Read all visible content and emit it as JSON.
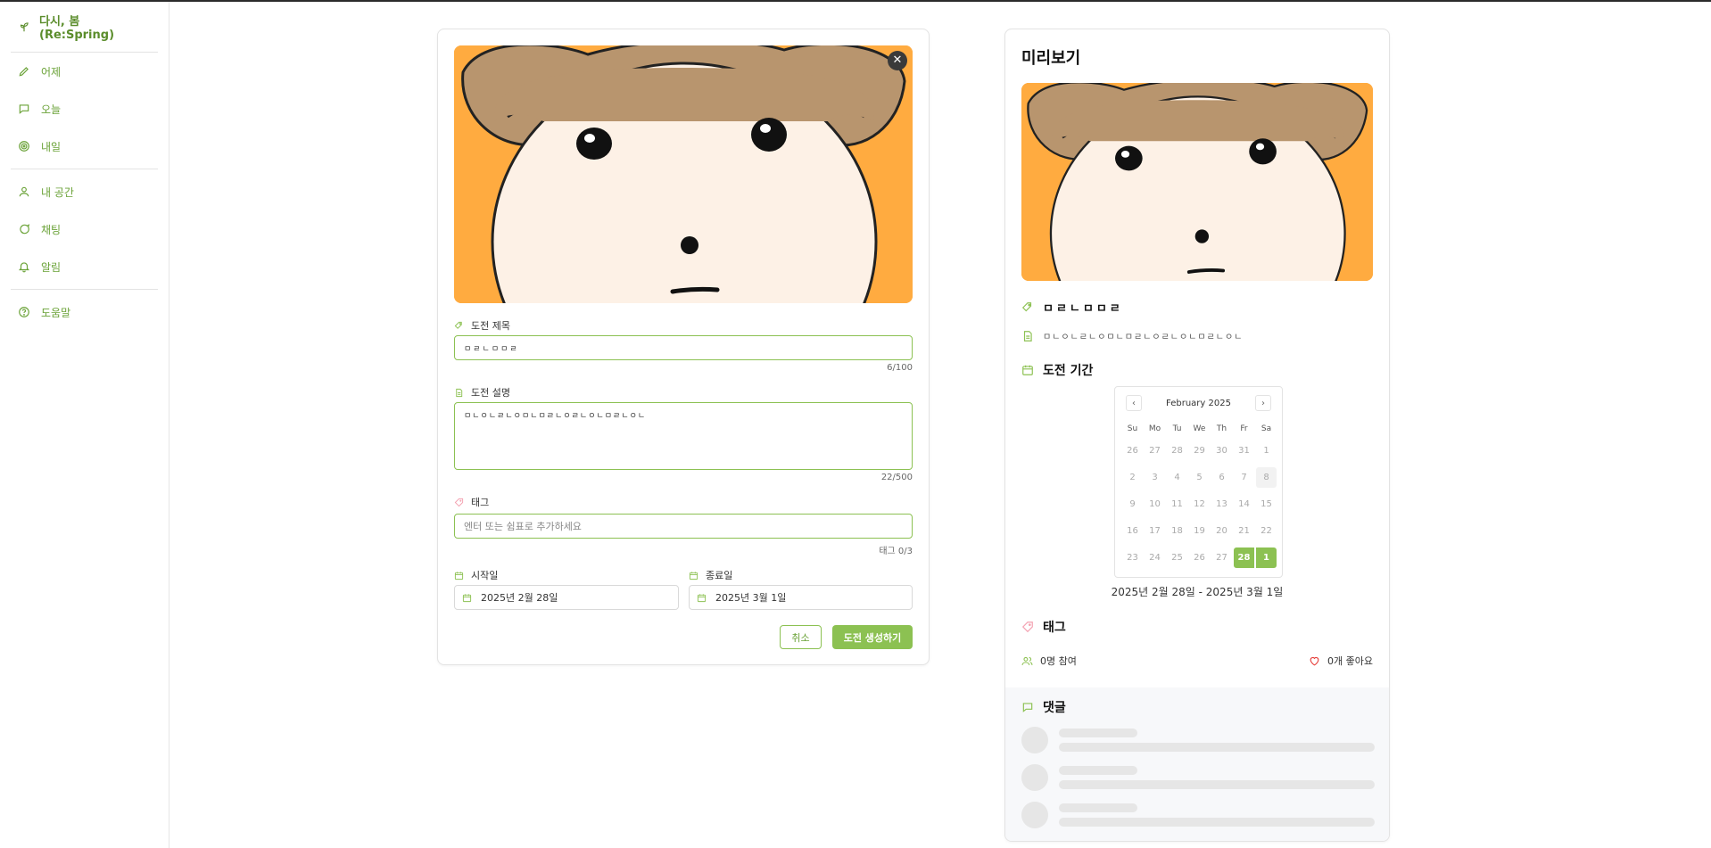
{
  "app": {
    "brand": "다시, 봄(Re:Spring)"
  },
  "sidebar": {
    "items": [
      {
        "label": "어제",
        "icon": "pencil-icon"
      },
      {
        "label": "오늘",
        "icon": "chat-icon"
      },
      {
        "label": "내일",
        "icon": "target-icon"
      },
      {
        "label": "내 공간",
        "icon": "user-icon"
      },
      {
        "label": "채팅",
        "icon": "chat-bubble-icon"
      },
      {
        "label": "알림",
        "icon": "bell-icon"
      },
      {
        "label": "도움말",
        "icon": "help-icon"
      }
    ]
  },
  "form": {
    "close_label": "✕",
    "title_label": "도전 제목",
    "title_value": "ㅁㄹㄴㅁㅁㄹ",
    "title_counter": "6/100",
    "desc_label": "도전 설명",
    "desc_value": "ㅁㄴㅇㄴㄹㄴㅇㅁㄴㅁㄹㄴㅇㄹㄴㅇㄴㅁㄹㄴㅇㄴ",
    "desc_counter": "22/500",
    "tag_label": "태그",
    "tag_placeholder": "엔터 또는 쉼표로 추가하세요",
    "tag_counter": "태그 0/3",
    "start_label": "시작일",
    "start_value": "2025년 2월 28일",
    "end_label": "종료일",
    "end_value": "2025년 3월 1일",
    "cancel_label": "취소",
    "create_label": "도전 생성하기"
  },
  "preview": {
    "title": "미리보기",
    "name": "ㅁㄹㄴㅁㅁㄹ",
    "desc": "ㅁㄴㅇㄴㄹㄴㅇㅁㄴㅁㄹㄴㅇㄹㄴㅇㄴㅁㄹㄴㅇㄴ",
    "period_label": "도전 기간",
    "calendar": {
      "month_label": "February 2025",
      "prev": "‹",
      "next": "›",
      "weekdays": [
        "Su",
        "Mo",
        "Tu",
        "We",
        "Th",
        "Fr",
        "Sa"
      ],
      "days": [
        "26",
        "27",
        "28",
        "29",
        "30",
        "31",
        "1",
        "2",
        "3",
        "4",
        "5",
        "6",
        "7",
        "8",
        "9",
        "10",
        "11",
        "12",
        "13",
        "14",
        "15",
        "16",
        "17",
        "18",
        "19",
        "20",
        "21",
        "22",
        "23",
        "24",
        "25",
        "26",
        "27",
        "28",
        "1"
      ],
      "today": "8",
      "selected": [
        "28",
        "1"
      ]
    },
    "date_range": "2025년 2월 28일 - 2025년 3월 1일",
    "tag_label": "태그",
    "participants": "0명 참여",
    "likes": "0개 좋아요",
    "comments_label": "댓글"
  },
  "colors": {
    "accent": "#8cc152",
    "accent_dark": "#6aa237",
    "image_bg": "#ffab40",
    "face": "#fdf1e6",
    "hair": "#b8956e"
  }
}
